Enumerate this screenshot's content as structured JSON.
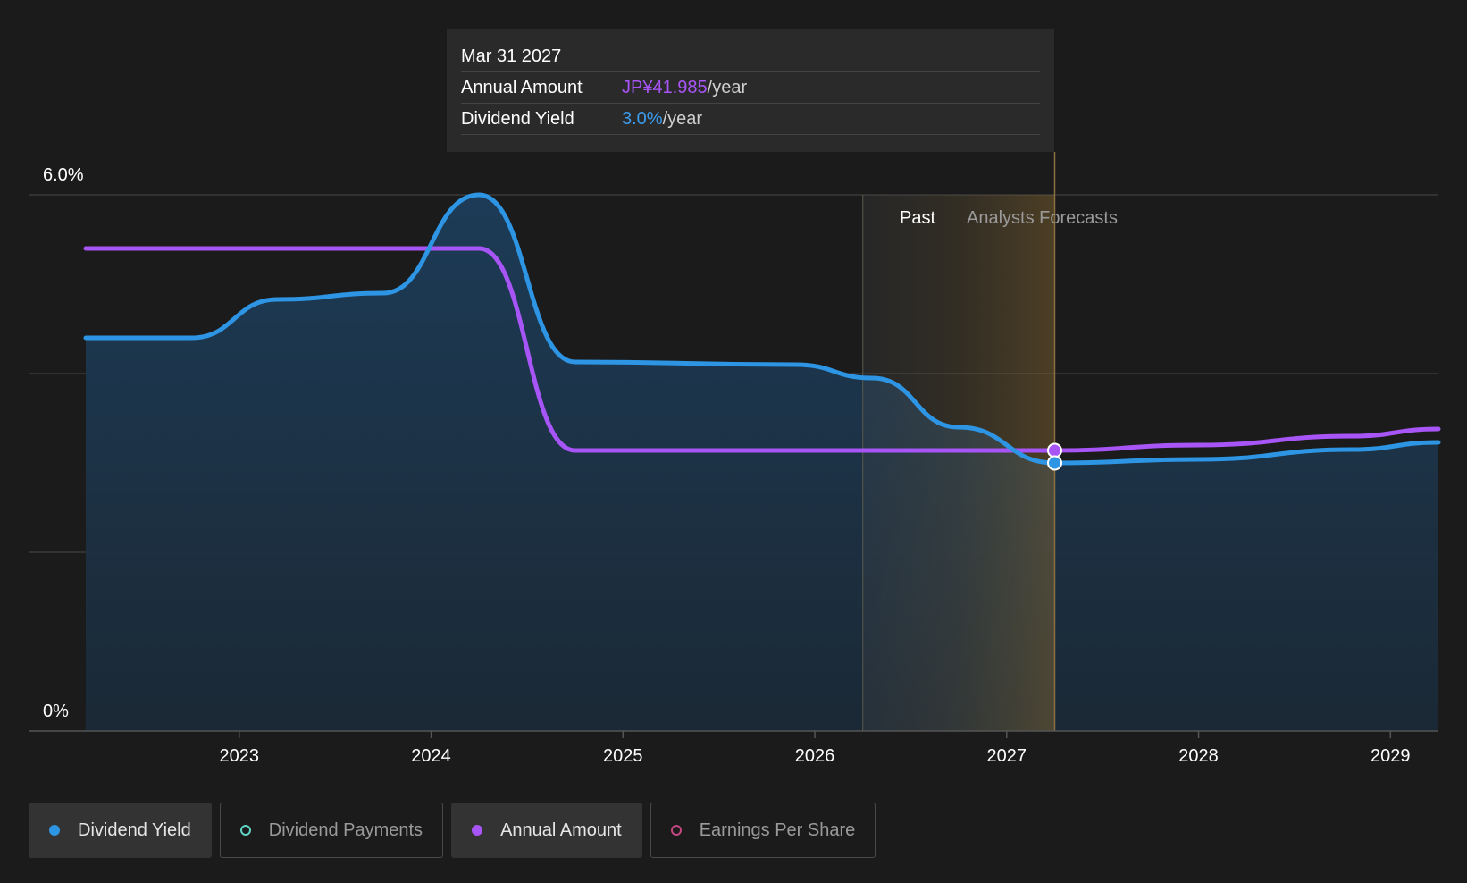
{
  "tooltip": {
    "date": "Mar 31 2027",
    "rows": [
      {
        "label": "Annual Amount",
        "value": "JP¥41.985",
        "suffix": "/year",
        "color": "#a855f7"
      },
      {
        "label": "Dividend Yield",
        "value": "3.0%",
        "suffix": "/year",
        "color": "#3b9ded"
      }
    ]
  },
  "region_labels": {
    "past": "Past",
    "forecast": "Analysts Forecasts"
  },
  "legend": [
    {
      "label": "Dividend Yield",
      "color": "#2d95e3",
      "active": true,
      "filled": true
    },
    {
      "label": "Dividend Payments",
      "color": "#5fd4c4",
      "active": false,
      "filled": false
    },
    {
      "label": "Annual Amount",
      "color": "#a855f7",
      "active": true,
      "filled": true
    },
    {
      "label": "Earnings Per Share",
      "color": "#c2467f",
      "active": false,
      "filled": false
    }
  ],
  "chart_data": {
    "type": "line",
    "title": "",
    "xlabel": "",
    "ylabel": "",
    "ylim": [
      0,
      6.0
    ],
    "xlim": [
      2022.2,
      2029.25
    ],
    "y_ticks": [
      {
        "value": 6.0,
        "label": "6.0%"
      },
      {
        "value": 0,
        "label": "0%"
      }
    ],
    "x_ticks": [
      2023,
      2024,
      2025,
      2026,
      2027,
      2028,
      2029
    ],
    "grid": true,
    "past_region": [
      2026.25,
      2027.25
    ],
    "highlight_x": 2027.25,
    "series": [
      {
        "name": "Dividend Yield",
        "color": "#2d95e3",
        "area": true,
        "points": [
          [
            2022.2,
            4.4
          ],
          [
            2022.75,
            4.4
          ],
          [
            2023.2,
            4.83
          ],
          [
            2023.75,
            4.9
          ],
          [
            2024.25,
            6.0
          ],
          [
            2024.75,
            4.13
          ],
          [
            2025.9,
            4.1
          ],
          [
            2026.3,
            3.95
          ],
          [
            2026.75,
            3.4
          ],
          [
            2027.25,
            3.0
          ],
          [
            2028.0,
            3.04
          ],
          [
            2028.8,
            3.15
          ],
          [
            2029.25,
            3.23
          ]
        ]
      },
      {
        "name": "Annual Amount",
        "color": "#a855f7",
        "area": false,
        "points": [
          [
            2022.2,
            5.4
          ],
          [
            2024.25,
            5.4
          ],
          [
            2024.75,
            3.14
          ],
          [
            2027.25,
            3.14
          ],
          [
            2028.0,
            3.2
          ],
          [
            2028.8,
            3.3
          ],
          [
            2029.25,
            3.38
          ]
        ]
      }
    ]
  }
}
